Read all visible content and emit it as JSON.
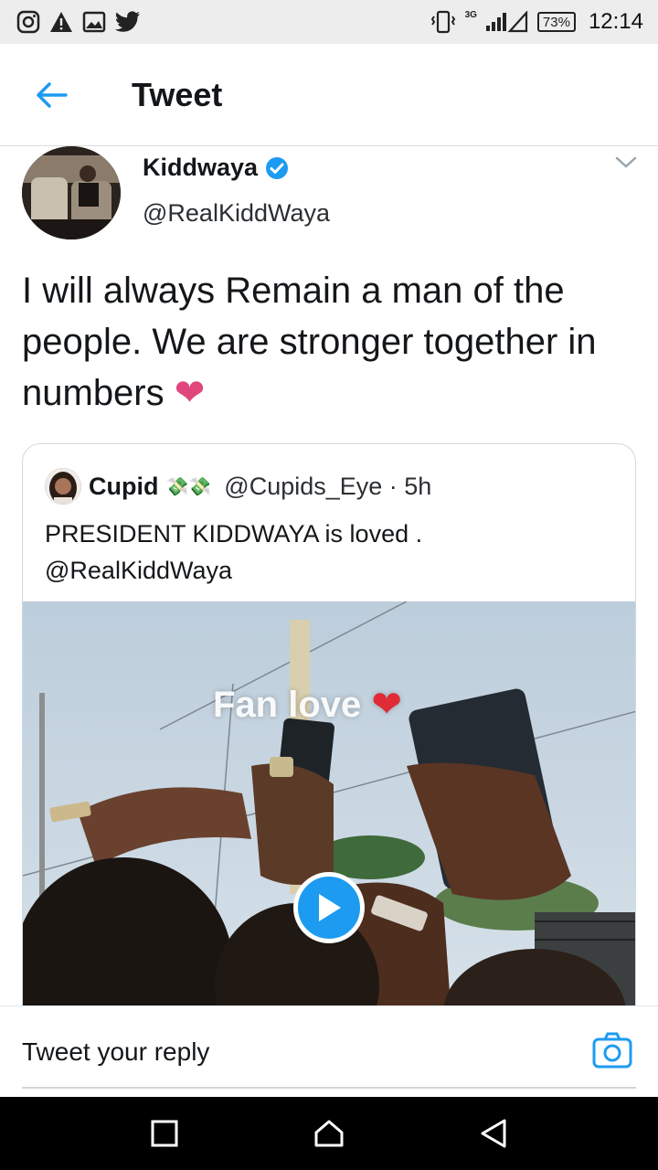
{
  "status_bar": {
    "network_label": "3G",
    "battery_text": "73%",
    "time": "12:14",
    "left_icons": [
      "instagram-icon",
      "warning-icon",
      "image-icon",
      "twitter-icon"
    ],
    "right_icons": [
      "vibrate-icon",
      "signal-icon",
      "battery-icon"
    ]
  },
  "header": {
    "title": "Tweet",
    "back_icon": "arrow-left-icon"
  },
  "tweet": {
    "author_name": "Kiddwaya",
    "verified": true,
    "author_handle": "@RealKiddWaya",
    "text": "I will always Remain a man of the people. We are stronger together in numbers",
    "emoji": "❤"
  },
  "quoted_tweet": {
    "author_name": "Cupid",
    "emoji": "💸💸",
    "handle_time": "@Cupids_Eye · 5h",
    "text": "PRESIDENT KIDDWAYA is loved . @RealKiddWaya",
    "media_overlay": "Fan love"
  },
  "reply": {
    "placeholder": "Tweet your reply"
  },
  "colors": {
    "accent": "#1d9bf0",
    "heart": "#e0457b",
    "status_bar_bg": "#ededed",
    "nav_bar_bg": "#000000"
  }
}
